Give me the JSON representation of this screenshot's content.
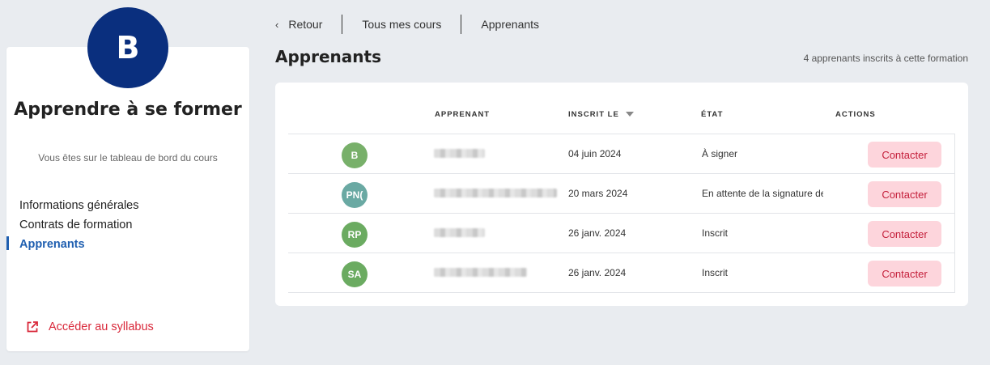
{
  "sidebar": {
    "avatar_initial": "B",
    "title": "Apprendre à se former",
    "subtitle": "Vous êtes sur le tableau de bord du cours",
    "nav": [
      {
        "label": "Informations générales",
        "active": false
      },
      {
        "label": "Contrats de formation",
        "active": false
      },
      {
        "label": "Apprenants",
        "active": true
      }
    ],
    "syllabus_link": "Accéder au syllabus",
    "syllabus_icon": "external-link-icon"
  },
  "breadcrumb": {
    "back_label": "Retour",
    "back_icon": "chevron-left-icon",
    "courses_label": "Tous mes cours",
    "current_label": "Apprenants"
  },
  "page": {
    "title": "Apprenants",
    "count_text": "4 apprenants inscrits à cette formation"
  },
  "table": {
    "headers": {
      "learner": "APPRENANT",
      "enrolled": "INSCRIT LE",
      "state": "ÉTAT",
      "actions": "ACTIONS"
    },
    "sort_icon": "caret-down-icon",
    "rows": [
      {
        "initials": "B",
        "avatar_color": "#78b06a",
        "date": "04 juin 2024",
        "state": "À signer",
        "action": "Contacter"
      },
      {
        "initials": "PN(",
        "avatar_color": "#6aa9a3",
        "date": "20 mars 2024",
        "state": "En attente de la signature de l'OF",
        "action": "Contacter"
      },
      {
        "initials": "RP",
        "avatar_color": "#6bab61",
        "date": "26 janv. 2024",
        "state": "Inscrit",
        "action": "Contacter"
      },
      {
        "initials": "SA",
        "avatar_color": "#6bab61",
        "date": "26 janv. 2024",
        "state": "Inscrit",
        "action": "Contacter"
      }
    ]
  },
  "colors": {
    "background": "#e9ecf0",
    "brand_navy": "#0a2f7e",
    "active_blue": "#1f5fb0",
    "danger_red": "#d9283a",
    "contact_button_bg": "#fdd5dc"
  }
}
